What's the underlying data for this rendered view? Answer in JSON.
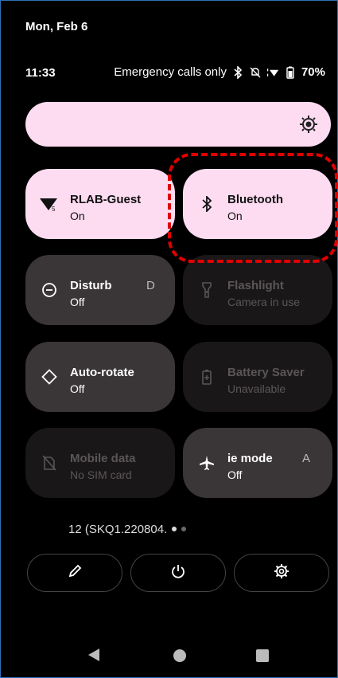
{
  "header": {
    "date": "Mon, Feb 6",
    "time": "11:33",
    "network_status": "Emergency calls only",
    "battery": "70%"
  },
  "tiles": [
    {
      "title": "RLAB-Guest",
      "sub": "On",
      "icon": "wifi-icon"
    },
    {
      "title": "Bluetooth",
      "sub": "On",
      "icon": "bluetooth-icon"
    },
    {
      "title": "Disturb",
      "title_trail": "D",
      "sub": "Off",
      "icon": "dnd-icon"
    },
    {
      "title": "Flashlight",
      "sub": "Camera in use",
      "icon": "flashlight-icon"
    },
    {
      "title": "Auto-rotate",
      "sub": "Off",
      "icon": "auto-rotate-icon"
    },
    {
      "title": "Battery Saver",
      "sub": "Unavailable",
      "icon": "battery-saver-icon"
    },
    {
      "title": "Mobile data",
      "sub": "No SIM card",
      "icon": "mobile-data-icon"
    },
    {
      "title": "ie mode",
      "title_trail": "A",
      "sub": "Off",
      "icon": "airplane-icon"
    }
  ],
  "build": "12 (SKQ1.220804.",
  "colors": {
    "tile_on": "#fddcf1",
    "tile_off": "#3a3536",
    "highlight": "#e00000"
  }
}
